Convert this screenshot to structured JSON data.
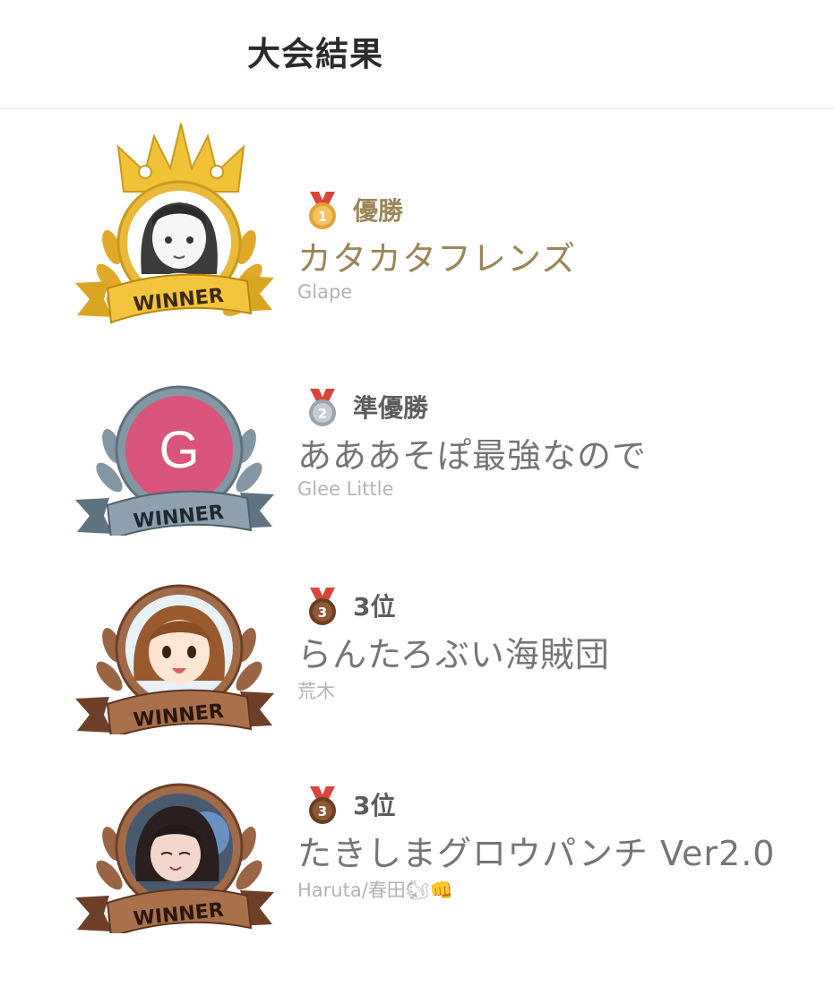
{
  "header": {
    "title": "大会結果"
  },
  "results": [
    {
      "rank_label": "優勝",
      "medal_number": "1",
      "team_name": "カタカタフレンズ",
      "player": "Glape",
      "badge_text": "WINNER",
      "avatar_letter": "",
      "colors": {
        "team": "#9a8659",
        "rank": "#9a8659"
      }
    },
    {
      "rank_label": "準優勝",
      "medal_number": "2",
      "team_name": "あああそぽ最強なので",
      "player": "Glee Little",
      "badge_text": "WINNER",
      "avatar_letter": "G",
      "colors": {
        "team": "#767676",
        "rank": "#5d5d5d"
      }
    },
    {
      "rank_label": "3位",
      "medal_number": "3",
      "team_name": "らんたろぶい海賊団",
      "player": "荒木",
      "badge_text": "WINNER",
      "avatar_letter": "",
      "colors": {
        "team": "#767676",
        "rank": "#5d5d5d"
      }
    },
    {
      "rank_label": "3位",
      "medal_number": "3",
      "team_name": "たきしまグロウパンチ Ver2.0",
      "player": "Haruta/春田🐿👊",
      "badge_text": "WINNER",
      "avatar_letter": "",
      "colors": {
        "team": "#767676",
        "rank": "#5d5d5d"
      }
    }
  ],
  "palette": {
    "gold": "#e5b62d",
    "silver": "#7a8a96",
    "bronze": "#8a5a3e",
    "avatar_pink": "#d9547c"
  }
}
